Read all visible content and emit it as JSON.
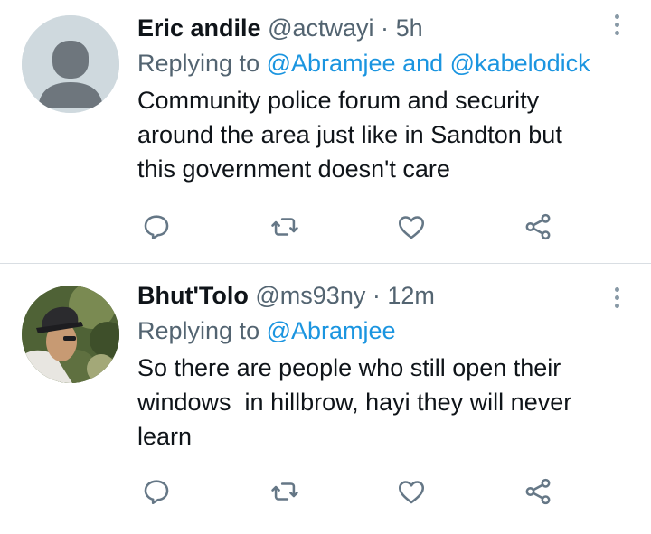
{
  "tweets": [
    {
      "name": "Eric andile",
      "handle": "@actwayi",
      "separator": "·",
      "time": "5h",
      "replying_prefix": "Replying to",
      "mention1": "@Abramjee",
      "conjunction": "and",
      "mention2": "@kabelodick",
      "lines": [
        "Community police forum and security",
        "around the area just like in Sandton but",
        "this government doesn't care"
      ],
      "avatar": "default-avatar"
    },
    {
      "name": "Bhut'Tolo",
      "handle": "@ms93ny",
      "separator": "·",
      "time": "12m",
      "replying_prefix": "Replying to",
      "mention1": "@Abramjee",
      "lines": [
        "So there are people who still open their",
        "windows  in hillbrow, hayi they will never",
        "learn"
      ],
      "avatar": "photo-avatar"
    }
  ],
  "icons": {
    "reply": "reply-icon",
    "retweet": "retweet-icon",
    "like": "heart-icon",
    "share": "share-icon",
    "menu": "more-vertical-icon"
  },
  "colors": {
    "mention": "#1b95e0",
    "secondary_text": "#536471",
    "icon": "#657786"
  }
}
